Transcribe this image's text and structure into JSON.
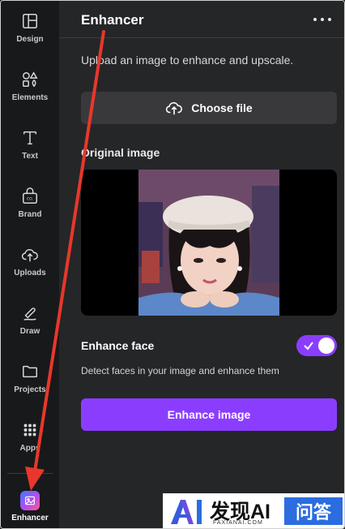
{
  "sidebar": {
    "items": [
      {
        "label": "Design",
        "icon": "layout-icon"
      },
      {
        "label": "Elements",
        "icon": "shapes-icon"
      },
      {
        "label": "Text",
        "icon": "text-icon"
      },
      {
        "label": "Brand",
        "icon": "brand-icon"
      },
      {
        "label": "Uploads",
        "icon": "cloud-upload-icon"
      },
      {
        "label": "Draw",
        "icon": "pen-icon"
      },
      {
        "label": "Projects",
        "icon": "folder-icon"
      },
      {
        "label": "Apps",
        "icon": "apps-grid-icon"
      }
    ],
    "active": {
      "label": "Enhancer",
      "icon": "enhancer-app-icon"
    }
  },
  "panel": {
    "title": "Enhancer",
    "intro": "Upload an image to enhance and upscale.",
    "choose_file": "Choose file",
    "original_label": "Original image",
    "enhance_face_label": "Enhance face",
    "enhance_face_on": true,
    "enhance_face_desc": "Detect faces in your image and enhance them",
    "enhance_button": "Enhance image"
  },
  "watermark": {
    "title": "发现AI",
    "subtitle": "FAXIANAI.COM",
    "box": "问答"
  },
  "colors": {
    "accent": "#8b3dff",
    "sidebar_bg": "#18191b",
    "panel_bg": "#252627",
    "arrow": "#e8372c"
  }
}
